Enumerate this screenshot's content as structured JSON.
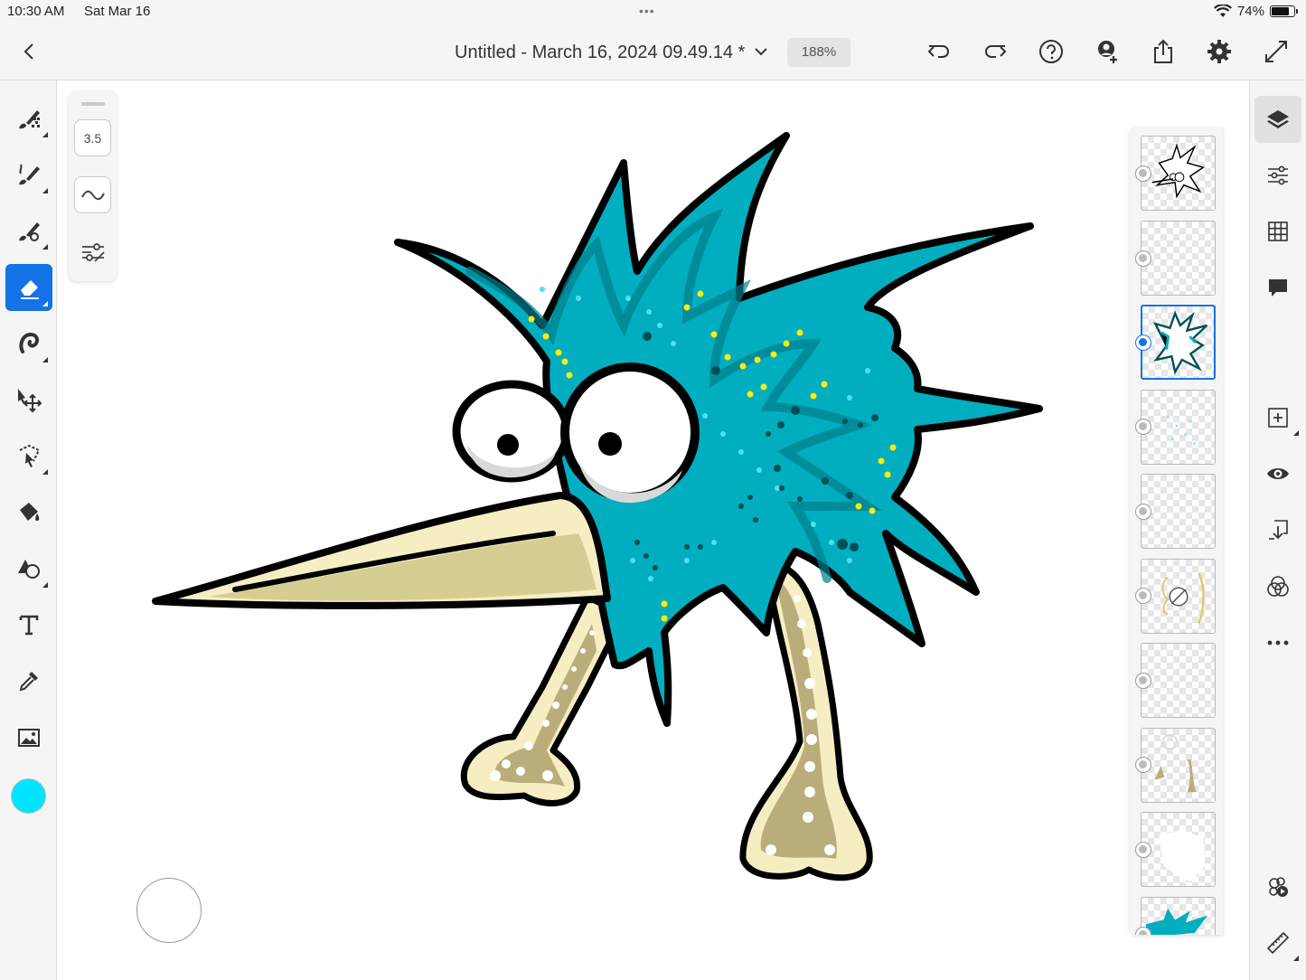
{
  "status_bar": {
    "time": "10:30 AM",
    "date": "Sat Mar 16",
    "battery": "74%",
    "multitask_dots": "•••"
  },
  "header": {
    "document_title": "Untitled - March 16, 2024 09.49.14 *",
    "zoom": "188%",
    "icons": [
      "back-icon",
      "chevron-down-icon",
      "undo-icon",
      "redo-icon",
      "help-icon",
      "invite-icon",
      "share-icon",
      "settings-icon",
      "fullscreen-icon"
    ]
  },
  "tools": {
    "items": [
      "pixel-brush-icon",
      "live-brush-icon",
      "vector-brush-icon",
      "eraser-icon",
      "smudge-icon",
      "transform-icon",
      "lasso-icon",
      "fill-icon",
      "shapes-icon",
      "text-icon",
      "eyedropper-icon",
      "image-icon"
    ],
    "active": "eraser-icon",
    "current_color": "#00e5ff"
  },
  "brush_panel": {
    "size": "3.5",
    "icons": [
      "smoothing-icon",
      "brush-settings-icon"
    ]
  },
  "layers": {
    "count": 10,
    "selected_index": 2,
    "icons": [
      "layers-icon",
      "layer-properties-icon",
      "grid-icon",
      "comment-icon",
      "add-layer-icon",
      "visibility-icon",
      "merge-down-icon",
      "blend-icon",
      "more-icon",
      "timelapse-icon",
      "ruler-icon"
    ]
  },
  "colors": {
    "accent": "#1473e6",
    "bird_teal": "#00aebf",
    "beak": "#f6eec2",
    "leg": "#b9ad7b"
  }
}
